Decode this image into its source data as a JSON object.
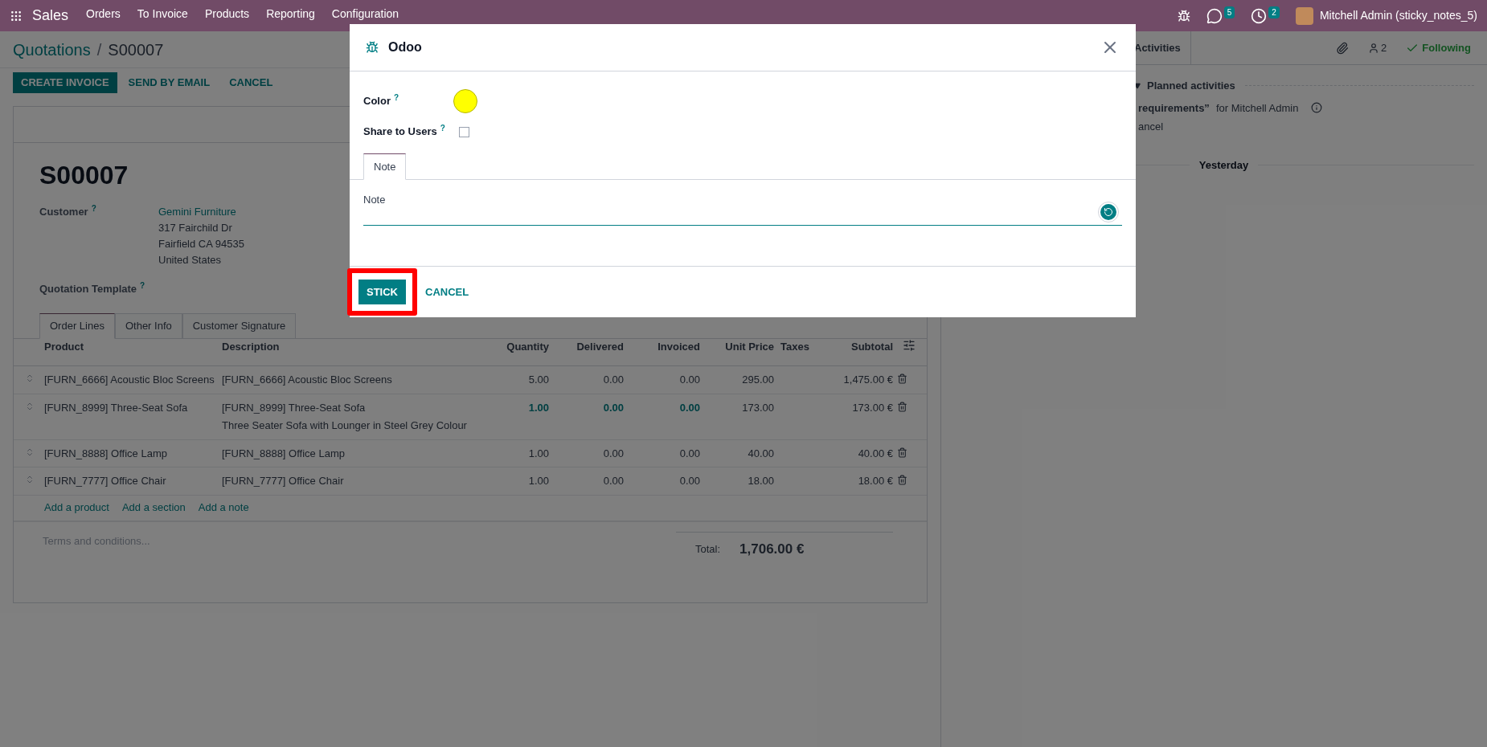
{
  "navbar": {
    "app": "Sales",
    "menu": [
      "Orders",
      "To Invoice",
      "Products",
      "Reporting",
      "Configuration"
    ],
    "messages_badge": "5",
    "activities_badge": "2",
    "user": "Mitchell Admin (sticky_notes_5)"
  },
  "breadcrumb": {
    "parent": "Quotations",
    "separator": "/",
    "current": "S00007"
  },
  "actions": [
    {
      "label": "CREATE INVOICE",
      "primary": true
    },
    {
      "label": "SEND BY EMAIL",
      "primary": false
    },
    {
      "label": "CANCEL",
      "primary": false
    }
  ],
  "form": {
    "name": "S00007",
    "customer_label": "Customer",
    "help_mark": "?",
    "customer": "Gemini Furniture",
    "address": [
      "317 Fairchild Dr",
      "Fairfield CA 94535",
      "United States"
    ],
    "template_label": "Quotation Template"
  },
  "tabs": [
    {
      "label": "Order Lines",
      "selected": true
    },
    {
      "label": "Other Info",
      "selected": false
    },
    {
      "label": "Customer Signature",
      "selected": false
    }
  ],
  "table": {
    "columns": [
      "Product",
      "Description",
      "Quantity",
      "Delivered",
      "Invoiced",
      "Unit Price",
      "Taxes",
      "Subtotal"
    ],
    "rows": [
      {
        "product": "[FURN_6666] Acoustic Bloc Screens",
        "description": [
          "[FURN_6666] Acoustic Bloc Screens"
        ],
        "quantity": "5.00",
        "delivered": "0.00",
        "invoiced": "0.00",
        "unit_price": "295.00",
        "subtotal": "1,475.00 €",
        "emphasis": false
      },
      {
        "product": "[FURN_8999] Three-Seat Sofa",
        "description": [
          "[FURN_8999] Three-Seat Sofa",
          "Three Seater Sofa with Lounger in Steel Grey Colour"
        ],
        "quantity": "1.00",
        "delivered": "0.00",
        "invoiced": "0.00",
        "unit_price": "173.00",
        "subtotal": "173.00 €",
        "emphasis": true
      },
      {
        "product": "[FURN_8888] Office Lamp",
        "description": [
          "[FURN_8888] Office Lamp"
        ],
        "quantity": "1.00",
        "delivered": "0.00",
        "invoiced": "0.00",
        "unit_price": "40.00",
        "subtotal": "40.00 €",
        "emphasis": false
      },
      {
        "product": "[FURN_7777] Office Chair",
        "description": [
          "[FURN_7777] Office Chair"
        ],
        "quantity": "1.00",
        "delivered": "0.00",
        "invoiced": "0.00",
        "unit_price": "18.00",
        "subtotal": "18.00 €",
        "emphasis": false
      }
    ],
    "add_links": [
      "Add a product",
      "Add a section",
      "Add a note"
    ],
    "terms_placeholder": "Terms and conditions...",
    "total_label": "Total:",
    "total": "1,706.00 €"
  },
  "chatter": {
    "activities_tab": "Activities",
    "followers_count": "2",
    "following": "Following",
    "planned": "Planned activities",
    "activity_title": "requirements”",
    "activity_for": "for Mitchell Admin",
    "activity_action": "ancel",
    "day": "Yesterday"
  },
  "modal": {
    "title": "Odoo",
    "color_label": "Color",
    "color": "#ffff00",
    "share_label": "Share to Users",
    "share_checked": false,
    "tab": "Note",
    "note": "Note",
    "buttons": [
      {
        "label": "STICK",
        "primary": true,
        "highlighted": true
      },
      {
        "label": "CANCEL",
        "primary": false,
        "highlighted": false
      }
    ]
  }
}
